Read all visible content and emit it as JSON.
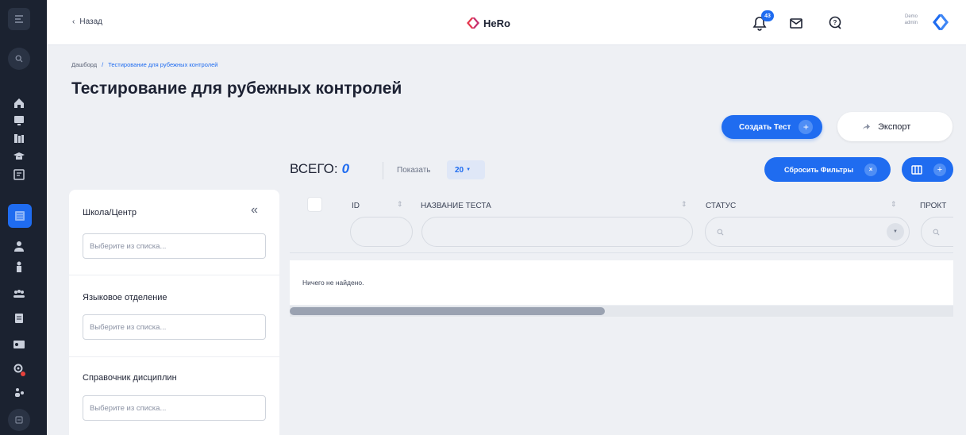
{
  "header": {
    "back_label": "Назад",
    "logo_text": "HeRo",
    "notifications_count": "43",
    "user_name": "Demo",
    "user_role": "admin"
  },
  "breadcrumb": {
    "home": "Дашборд",
    "separator": "/",
    "current": "Тестирование для рубежных контролей"
  },
  "page": {
    "title": "Тестирование для рубежных контролей",
    "create_button": "Создать Тест",
    "export_button": "Экспорт"
  },
  "toolbar": {
    "total_label": "ВСЕГО:",
    "total_value": "0",
    "show_label": "Показать",
    "page_size": "20",
    "reset_filters": "Сбросить Фильтры"
  },
  "filters": {
    "items": [
      {
        "label": "Школа/Центр",
        "placeholder": "Выберите из списка..."
      },
      {
        "label": "Языковое отделение",
        "placeholder": "Выберите из списка..."
      },
      {
        "label": "Справочник дисциплин",
        "placeholder": "Выберите из списка..."
      }
    ]
  },
  "table": {
    "columns": [
      "ID",
      "НАЗВАНИЕ ТЕСТА",
      "СТАТУС",
      "ПРОКТ"
    ],
    "empty_message": "Ничего не найдено."
  },
  "colors": {
    "accent": "#1f6cf0",
    "sidebar": "#1b2230",
    "background": "#eef0f4"
  },
  "icons": [
    "menu-icon",
    "search-icon",
    "home-icon",
    "monitor-icon",
    "books-icon",
    "graduation-cap-icon",
    "contract-icon",
    "list-icon",
    "person-icon",
    "teacher-icon",
    "group-icon",
    "document-icon",
    "id-card-icon",
    "gear-icon",
    "users-icon",
    "logout-icon",
    "bell-icon",
    "mail-icon",
    "help-icon",
    "columns-icon",
    "share-icon"
  ]
}
